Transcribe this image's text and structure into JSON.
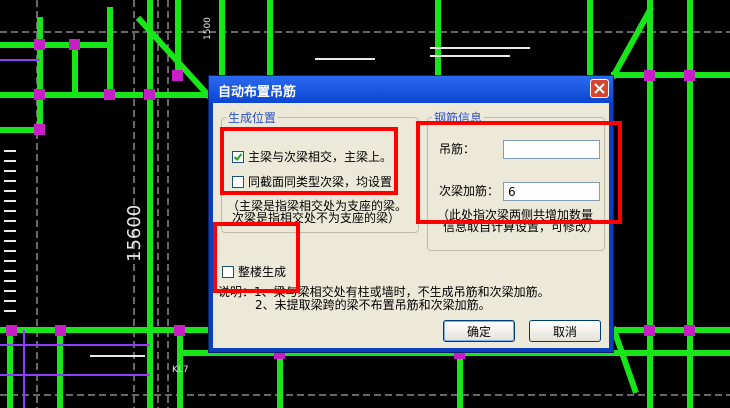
{
  "cad": {
    "dimension_large": "15600",
    "dimension_small": "1500",
    "label_bottom": "KL7"
  },
  "dialog": {
    "title": "自动布置吊筋",
    "close_icon": "close-icon",
    "position_group": {
      "legend": "生成位置",
      "option_primary_secondary": {
        "label": "主梁与次梁相交，主梁上。",
        "checked": true
      },
      "option_same_section": {
        "label": "同截面同类型次梁，均设置",
        "checked": false
      },
      "note_line1": "（主梁是指梁相交处为支座的梁。",
      "note_line2": "次梁是指相交处不为支座的梁）"
    },
    "rebar_group": {
      "legend": "钢筋信息",
      "hanger_label": "吊筋：",
      "hanger_value": "",
      "secondary_label": "次梁加筋：",
      "secondary_value": "6",
      "note_line1": "（此处指次梁两侧共增加数量",
      "note_line2": "信息取自计算设置，可修改）"
    },
    "whole_building": {
      "label": "整楼生成",
      "checked": false
    },
    "explain_line1": "说明：1、梁与梁相交处有柱或墙时，不生成吊筋和次梁加筋。",
    "explain_line2": "2、未提取梁跨的梁不布置吊筋和次梁加筋。",
    "ok_label": "确定",
    "cancel_label": "取消"
  },
  "colors": {
    "beam": "#19e619",
    "node": "#c81ec8",
    "dialog_frame": "#0b3fc0",
    "highlight": "#ff0000"
  }
}
